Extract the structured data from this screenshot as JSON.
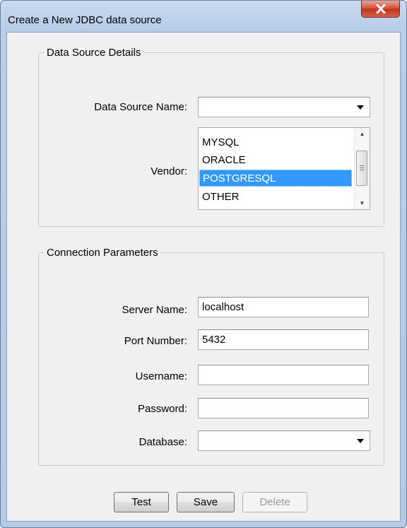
{
  "window": {
    "title": "Create a New JDBC data source",
    "close_icon": "close-icon"
  },
  "data_source_details": {
    "legend": "Data Source Details",
    "name_label": "Data Source Name:",
    "name_value": "",
    "vendor_label": "Vendor:",
    "vendor_options": [
      "MYSQL",
      "ORACLE",
      "POSTGRESQL",
      "OTHER"
    ],
    "vendor_selected": "POSTGRESQL"
  },
  "connection_parameters": {
    "legend": "Connection Parameters",
    "server_label": "Server Name:",
    "server_value": "localhost",
    "port_label": "Port Number:",
    "port_value": "5432",
    "username_label": "Username:",
    "username_value": "",
    "password_label": "Password:",
    "password_value": "",
    "database_label": "Database:",
    "database_value": ""
  },
  "buttons": {
    "test": "Test",
    "save": "Save",
    "delete": "Delete"
  },
  "colors": {
    "selection": "#3399ff",
    "close_button": "#c7432b"
  }
}
